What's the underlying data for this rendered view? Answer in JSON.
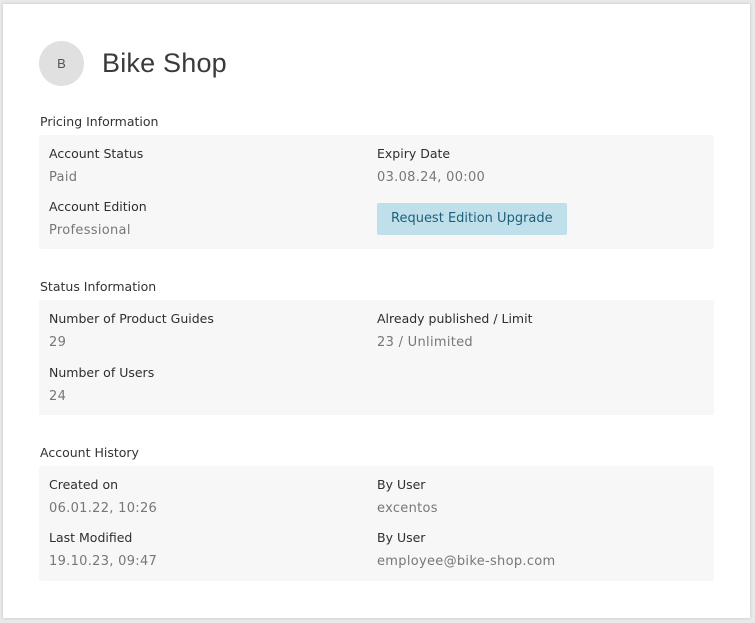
{
  "account": {
    "avatar_initial": "B",
    "name": "Bike Shop"
  },
  "pricing": {
    "section_title": "Pricing Information",
    "account_status_label": "Account Status",
    "account_status_value": "Paid",
    "expiry_date_label": "Expiry Date",
    "expiry_date_value": "03.08.24, 00:00",
    "account_edition_label": "Account Edition",
    "account_edition_value": "Professional",
    "upgrade_button_label": "Request Edition Upgrade"
  },
  "status": {
    "section_title": "Status Information",
    "product_guides_label": "Number of Product Guides",
    "product_guides_value": "29",
    "published_label": "Already published / Limit",
    "published_value": "23 / Unlimited",
    "users_label": "Number of Users",
    "users_value": "24"
  },
  "history": {
    "section_title": "Account History",
    "created_on_label": "Created on",
    "created_on_value": "06.01.22, 10:26",
    "created_by_label": "By User",
    "created_by_value": "excentos",
    "last_modified_label": "Last Modified",
    "last_modified_value": "19.10.23, 09:47",
    "modified_by_label": "By User",
    "modified_by_value": "employee@bike-shop.com"
  },
  "colors": {
    "button_bg": "#bfe0ea",
    "button_text": "#1f5f7a",
    "panel_bg": "#f7f7f7"
  }
}
